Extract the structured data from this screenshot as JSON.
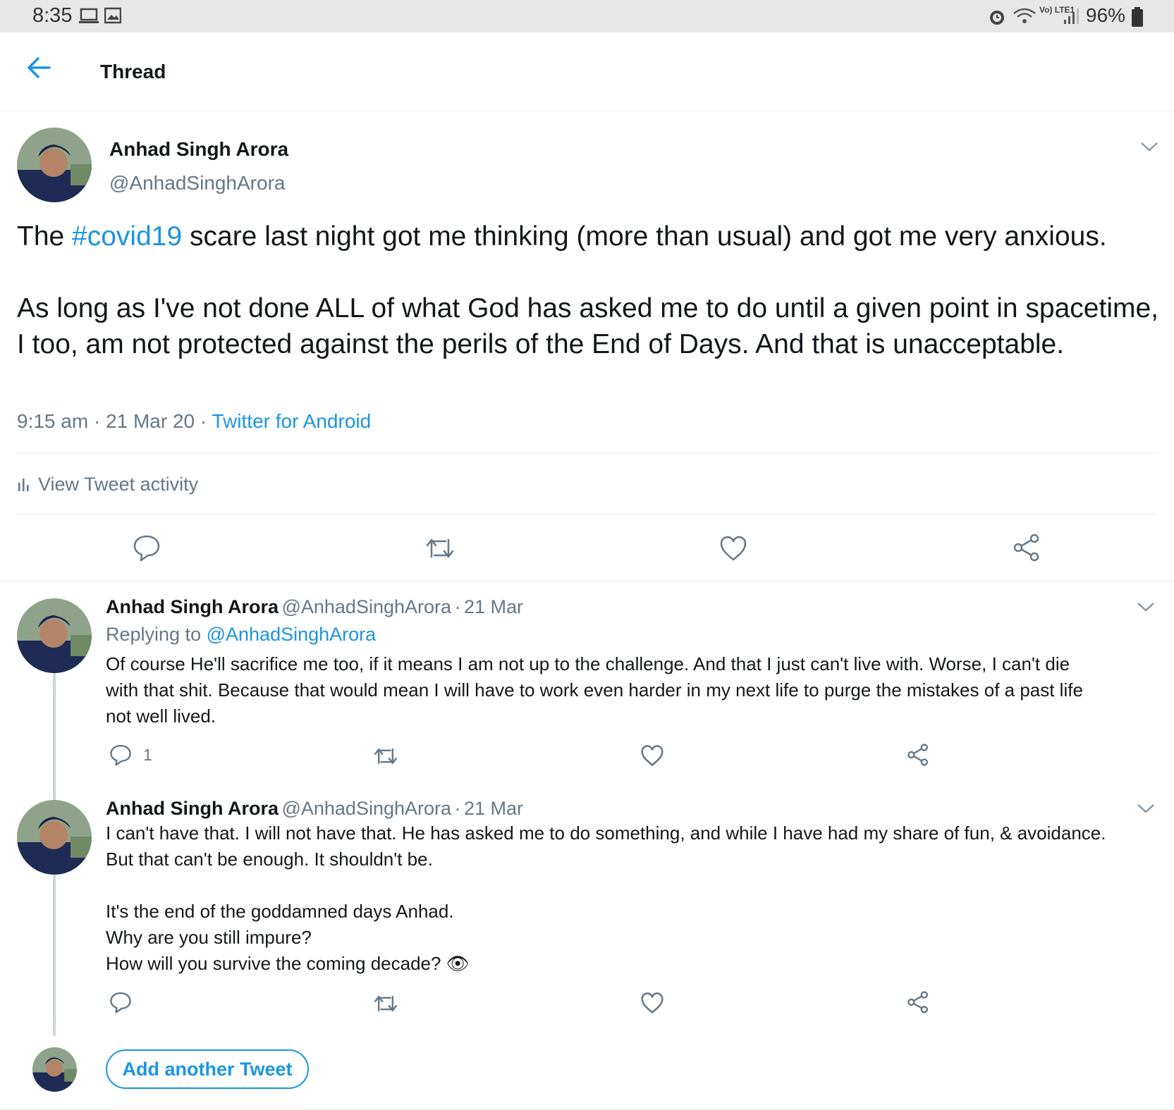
{
  "status_bar": {
    "time": "8:35",
    "battery": "96%",
    "network": "Vo) LTE1"
  },
  "header": {
    "title": "Thread"
  },
  "main_tweet": {
    "name": "Anhad Singh Arora",
    "handle": "@AnhadSinghArora",
    "text_before_hashtag": "The ",
    "hashtag": "#covid19",
    "text_after_hashtag": " scare last night got me thinking (more than usual) and got me very anxious.\n\nAs long as I've not done ALL of what God has asked me to do until a given point in spacetime, I too, am not protected against the perils of the End of Days. And that is unacceptable.",
    "time": "9:15 am",
    "date": "21 Mar 20",
    "source": "Twitter for Android",
    "activity_label": "View Tweet activity"
  },
  "replies": [
    {
      "name": "Anhad Singh Arora",
      "handle": "@AnhadSinghArora",
      "date": "21 Mar",
      "replying_label": "Replying to",
      "replying_handle": "@AnhadSinghArora",
      "text": "Of course He'll sacrifice me too, if it means I am not up to the challenge. And that I just can't live with. Worse, I can't die\nwith that shit. Because that would mean I will have to work even harder in my next life to purge the mistakes of a past life\nnot well lived.",
      "reply_count": "1"
    },
    {
      "name": "Anhad Singh Arora",
      "handle": "@AnhadSinghArora",
      "date": "21 Mar",
      "text": "I can't have that. I will not have that. He has asked me to do something, and while I have had my share of fun, & avoidance.\nBut that can't be enough. It shouldn't be.\n\nIt's the end of the goddamned days Anhad.\nWhy are you still impure?\nHow will you survive the coming decade? 👁"
    }
  ],
  "composer": {
    "add_label": "Add another Tweet"
  },
  "colors": {
    "accent": "#1b95e0",
    "secondary_text": "#657786",
    "divider": "#e6ecf0"
  }
}
